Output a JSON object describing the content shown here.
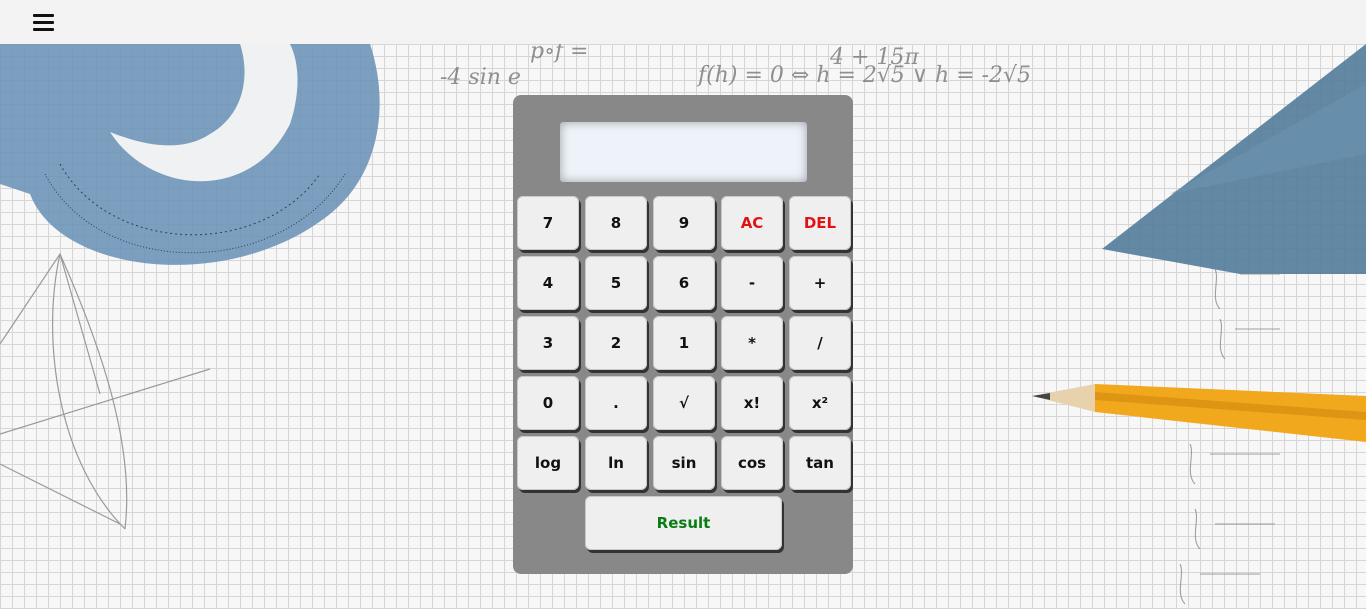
{
  "header": {
    "menu_icon": "hamburger-menu-icon"
  },
  "background": {
    "description_icons": [
      "protractor-icon",
      "set-square-icon",
      "pencil-icon"
    ],
    "handwriting": [
      "f(h) = 0 <=> h = 2√5 V h = -2√5",
      "4 + 15π"
    ]
  },
  "calculator": {
    "display_value": "",
    "buttons": [
      [
        "7",
        "8",
        "9",
        "AC",
        "DEL"
      ],
      [
        "4",
        "5",
        "6",
        "-",
        "+"
      ],
      [
        "3",
        "2",
        "1",
        "*",
        "/"
      ],
      [
        "0",
        ".",
        "√",
        "x!",
        "x²"
      ],
      [
        "log",
        "ln",
        "sin",
        "cos",
        "tan"
      ]
    ],
    "result_label": "Result"
  },
  "colors": {
    "calculator_body": "#888888",
    "button_face": "#efefef",
    "clear_text": "#e01414",
    "result_text": "#0a7d12",
    "display": "#eef3fa"
  }
}
